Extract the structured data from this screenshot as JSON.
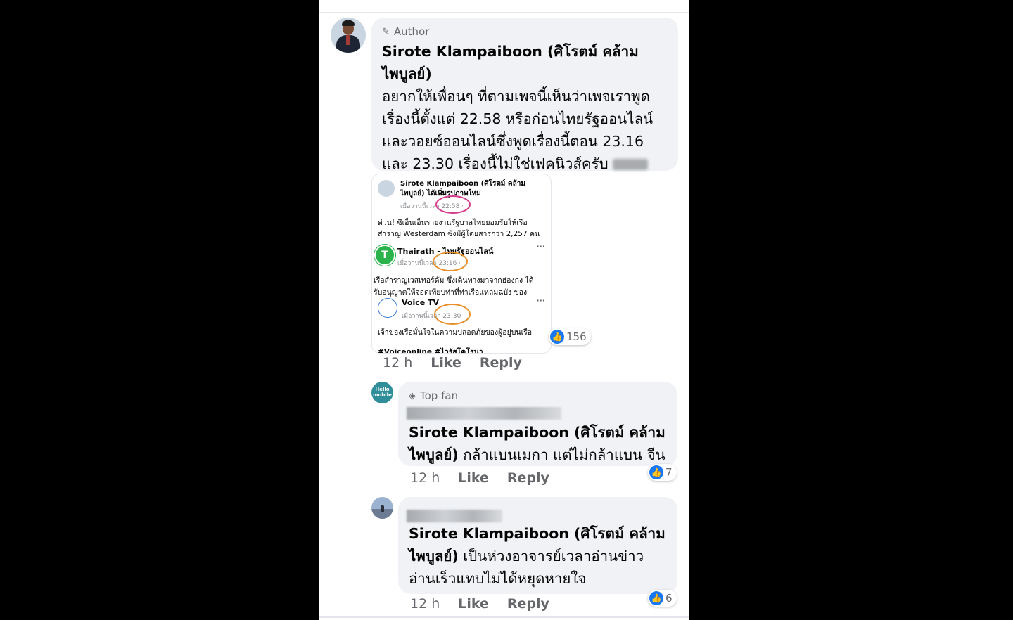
{
  "author_comment": {
    "badge": "Author",
    "name": "Sirote Klampaiboon (ศิโรตม์ คล้ามไพบูลย์)",
    "text": "อยากให้เพื่อนๆ ที่ตามเพจนี้เห็นว่าเพจเราพูดเรื่องนี้ตั้งแต่ 22.58 หรือก่อนไทยรัฐออนไลน์และวอยซ์ออนไลน์ซึ่งพูดเรื่องนี้ตอน 23.16 และ 23.30 เรื่องนี้ไม่ใช่เฟคนิวส์ครับ",
    "time": "12 h",
    "like": "Like",
    "reply": "Reply",
    "reactions": "156"
  },
  "screenshot": {
    "post1_name": "Sirote Klampaiboon (ศิโรตม์ คล้าม",
    "post1_name2": "ไพบูลย์) ได้เพิ่มรูปภาพใหม่",
    "post1_time": "เมื่อวานนี้เวลา 22:58 · ",
    "post1_text1": "ด่วน! ซีเอ็นเอ็นรายงานรัฐบาลไทยยอมรับให้เรือ",
    "post1_text2": "สำราญ Westerdam ซึ่งมีผู้โดยสารกว่า 2,257 คน",
    "post2_name": "Thairath - ไทยรัฐออนไลน์",
    "post2_time": "เมื่อวานนี้เวลา 23:16 · ",
    "post2_text1": "เรือสำราญเวสเทอร์ดัม ซึ่งเดินทางมาจากฮ่องกง ได้",
    "post2_text2": "รับอนุญาตให้จอดเทียบท่าที่ท่าเรือแหลมฉบัง ของ",
    "post3_name": "Voice TV",
    "post3_time": "เมื่อวานนี้เวลา 23:30 · ",
    "post3_text1": "เจ้าของเรือมั่นใจในความปลอดภัยของผู้อยู่บนเรือ",
    "post3_text2": "#Voiceonline #ไวรัสโคโรนา",
    "dots": "···",
    "logo_t": "T"
  },
  "reply1": {
    "badge": "Top fan",
    "name": "Sirote Klampaiboon (ศิโรตม์ คล้าม",
    "text_line2_name": "ไพบูลย์)",
    "text": " กล้าแบนเมกา แต่ไม่กล้าแบน จีน",
    "time": "12 h",
    "like": "Like",
    "reply": "Reply",
    "reactions": "7",
    "avatar_text": "Hello mobile"
  },
  "reply2": {
    "name": "Sirote Klampaiboon (ศิโรตม์ คล้าม",
    "text_line2_name": "ไพบูลย์)",
    "text_line2": " เป็นห่วงอาจารย์เวลาอ่านข่าว",
    "text_line3": "อ่านเร็วแทบไม่ได้หยุดหายใจ",
    "time": "12 h",
    "like": "Like",
    "reply": "Reply",
    "reactions": "6"
  },
  "icons": {
    "author_badge": "pencil-icon",
    "top_fan_badge": "diamond-icon",
    "like_reaction": "thumbs-up-icon"
  },
  "colors": {
    "like_blue": "#1877f2",
    "bubble_gray": "#f0f2f5",
    "pink_circle": "#d63a8a",
    "orange_circle": "#e8912c"
  }
}
